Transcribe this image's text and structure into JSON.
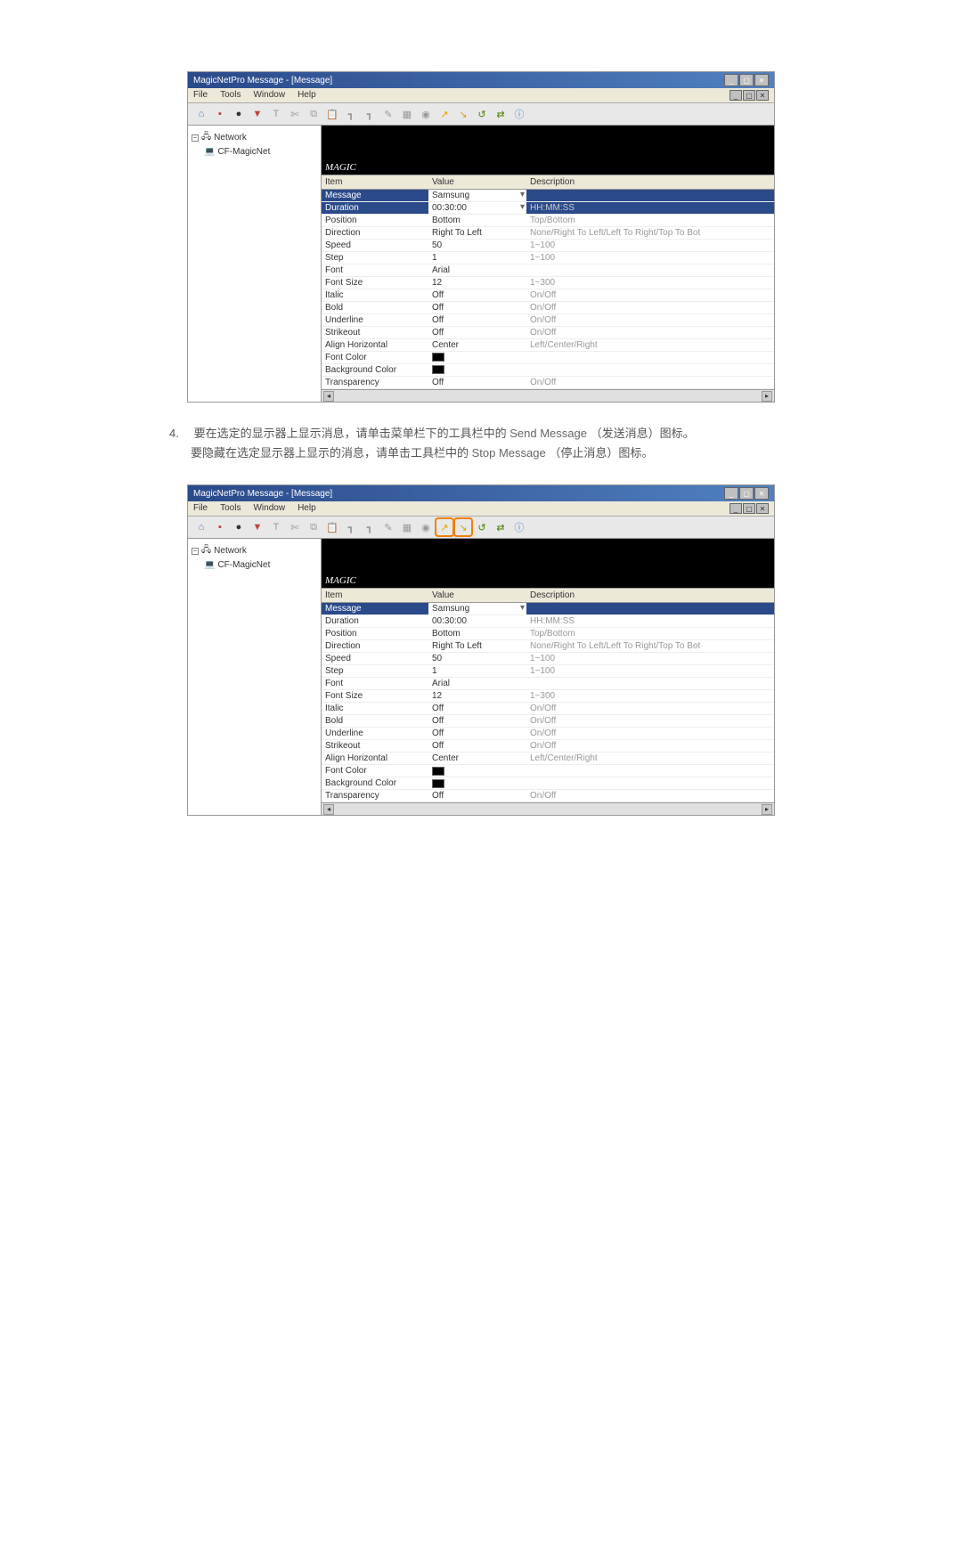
{
  "app_title": "MagicNetPro Message - [Message]",
  "menu": {
    "file": "File",
    "tools": "Tools",
    "window": "Window",
    "help": "Help"
  },
  "toolbar_icons": [
    {
      "name": "icon-a",
      "glyph": "⌂",
      "cls": "ic-blue"
    },
    {
      "name": "icon-b",
      "glyph": "▪",
      "cls": "ic-red"
    },
    {
      "name": "icon-c",
      "glyph": "●",
      "cls": "ic-black"
    },
    {
      "name": "icon-d",
      "glyph": "▼",
      "cls": "ic-red"
    },
    {
      "name": "icon-e",
      "glyph": "T",
      "cls": "ic-gray"
    },
    {
      "name": "icon-f",
      "glyph": "✄",
      "cls": "ic-gray"
    },
    {
      "name": "icon-g",
      "glyph": "⧉",
      "cls": "ic-gray"
    },
    {
      "name": "icon-h",
      "glyph": "📋",
      "cls": "ic-gray"
    },
    {
      "name": "icon-i",
      "glyph": "┓",
      "cls": "ic-gray"
    },
    {
      "name": "icon-j",
      "glyph": "┓",
      "cls": "ic-gray"
    },
    {
      "name": "icon-k",
      "glyph": "✎",
      "cls": "ic-gray"
    },
    {
      "name": "icon-l",
      "glyph": "▦",
      "cls": "ic-gray"
    },
    {
      "name": "icon-m",
      "glyph": "◉",
      "cls": "ic-gray"
    },
    {
      "name": "send-message-icon",
      "glyph": "↗",
      "cls": "ic-orange"
    },
    {
      "name": "stop-message-icon",
      "glyph": "↘",
      "cls": "ic-orange"
    },
    {
      "name": "icon-p",
      "glyph": "↺",
      "cls": "ic-green"
    },
    {
      "name": "icon-q",
      "glyph": "⇄",
      "cls": "ic-green"
    },
    {
      "name": "icon-info",
      "glyph": "ⓘ",
      "cls": "ic-info"
    }
  ],
  "tree": {
    "root_label": "Network",
    "child_label": "CF-MagicNet"
  },
  "preview_label": "MAGIC",
  "headers": {
    "item": "Item",
    "value": "Value",
    "description": "Description"
  },
  "props": [
    {
      "item": "Message",
      "value": "Samsung",
      "desc": "",
      "sel": true
    },
    {
      "item": "Duration",
      "value": "00:30:00",
      "desc": "HH:MM:SS",
      "sel": true
    },
    {
      "item": "Position",
      "value": "Bottom",
      "desc": "Top/Bottom"
    },
    {
      "item": "Direction",
      "value": "Right To Left",
      "desc": "None/Right To Left/Left To Right/Top To Bot"
    },
    {
      "item": "Speed",
      "value": "50",
      "desc": "1~100"
    },
    {
      "item": "Step",
      "value": "1",
      "desc": "1~100"
    },
    {
      "item": "Font",
      "value": "Arial",
      "desc": ""
    },
    {
      "item": "Font Size",
      "value": "12",
      "desc": "1~300"
    },
    {
      "item": "Italic",
      "value": "Off",
      "desc": "On/Off"
    },
    {
      "item": "Bold",
      "value": "Off",
      "desc": "On/Off"
    },
    {
      "item": "Underline",
      "value": "Off",
      "desc": "On/Off"
    },
    {
      "item": "Strikeout",
      "value": "Off",
      "desc": "On/Off"
    },
    {
      "item": "Align Horizontal",
      "value": "Center",
      "desc": "Left/Center/Right"
    },
    {
      "item": "Font Color",
      "value": "",
      "desc": "",
      "swatch": true
    },
    {
      "item": "Background Color",
      "value": "",
      "desc": "",
      "swatch": true
    },
    {
      "item": "Transparency",
      "value": "Off",
      "desc": "On/Off"
    }
  ],
  "instr": {
    "num": "4.",
    "line1a": "要在选定的显示器上显示消息，请单击菜单栏下的工具栏中的 ",
    "line1b": "Send Message",
    "line1c": "（发送消息）图标。",
    "line2a": "要隐藏在选定显示器上显示的消息，请单击工具栏中的 ",
    "line2b": "Stop Message",
    "line2c": "（停止消息）图标。"
  }
}
